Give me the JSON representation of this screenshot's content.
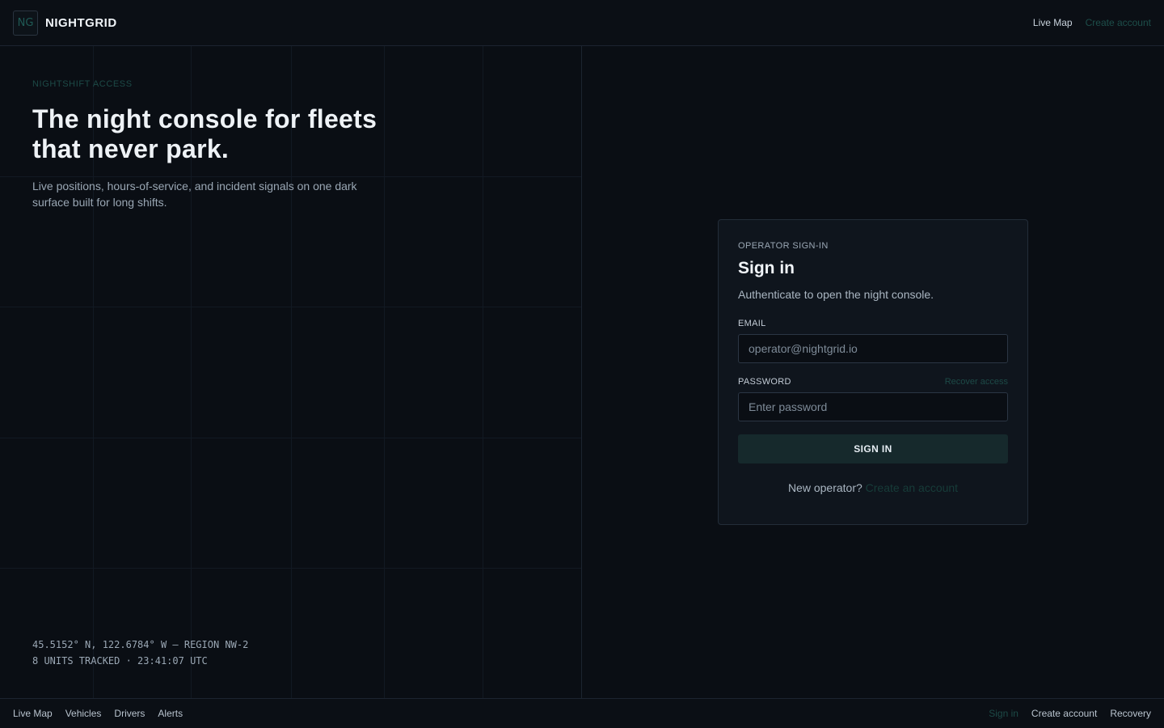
{
  "header": {
    "logo_text": "NG",
    "brand": "NIGHTGRID",
    "nav": [
      {
        "label": "Live Map"
      },
      {
        "label": "Create account"
      }
    ]
  },
  "hero": {
    "eyebrow": "NIGHTSHIFT ACCESS",
    "title": "The night console for fleets that never park.",
    "subtitle": "Live positions, hours-of-service, and incident signals on one dark surface built for long shifts.",
    "coords_line1": "45.5152° N, 122.6784° W — REGION NW-2",
    "coords_line2": "8 UNITS TRACKED · 23:41:07 UTC"
  },
  "signin": {
    "eyebrow": "OPERATOR SIGN-IN",
    "title": "Sign in",
    "subtitle": "Authenticate to open the night console.",
    "email_label": "EMAIL",
    "email_placeholder": "operator@nightgrid.io",
    "password_label": "PASSWORD",
    "recover_label": "Recover access",
    "password_placeholder": "Enter password",
    "button_label": "SIGN IN",
    "footer_text": "New operator?",
    "create_link": "Create an account"
  },
  "footer": {
    "left": [
      {
        "label": "Live Map"
      },
      {
        "label": "Vehicles"
      },
      {
        "label": "Drivers"
      },
      {
        "label": "Alerts"
      }
    ],
    "right": [
      {
        "label": "Sign in"
      },
      {
        "label": "Create account"
      },
      {
        "label": "Recovery"
      }
    ]
  },
  "colors": {
    "background": "#0a0e14",
    "accent": "#1d4a47",
    "button": "#16292c"
  }
}
